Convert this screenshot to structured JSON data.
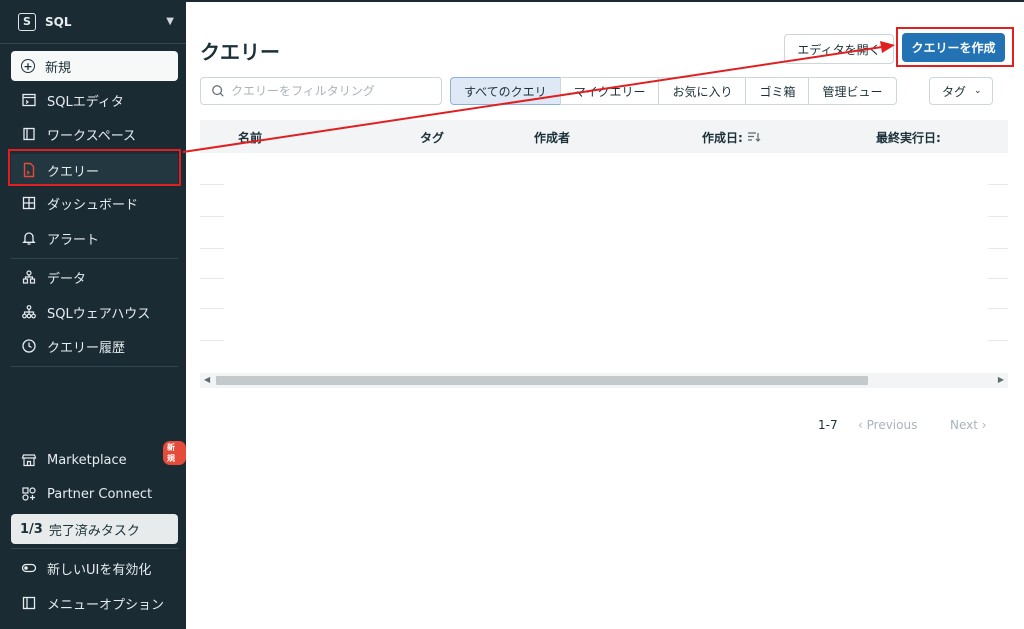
{
  "sidebar": {
    "app_name": "SQL",
    "logo_letter": "S",
    "new_label": "新規",
    "items": [
      {
        "label": "SQLエディタ",
        "icon": "sql-editor-icon"
      },
      {
        "label": "ワークスペース",
        "icon": "workspace-icon"
      },
      {
        "label": "クエリー",
        "icon": "query-icon"
      },
      {
        "label": "ダッシュボード",
        "icon": "dashboard-icon"
      },
      {
        "label": "アラート",
        "icon": "bell-icon"
      },
      {
        "label": "データ",
        "icon": "data-icon"
      },
      {
        "label": "SQLウェアハウス",
        "icon": "warehouse-icon"
      },
      {
        "label": "クエリー履歴",
        "icon": "clock-icon"
      },
      {
        "label": "Marketplace",
        "icon": "store-icon"
      },
      {
        "label": "Partner Connect",
        "icon": "partner-icon"
      },
      {
        "label": "新しいUIを有効化",
        "icon": "toggle-icon"
      },
      {
        "label": "メニューオプション",
        "icon": "panel-icon"
      }
    ],
    "marketplace_badge": "新規",
    "task_count": "1/3",
    "task_label": "完了済みタスク"
  },
  "main": {
    "title": "クエリー",
    "open_editor_label": "エディタを開く",
    "create_label": "クエリーを作成",
    "search_placeholder": "クエリーをフィルタリング",
    "filters": [
      "すべてのクエリ",
      "マイクエリー",
      "お気に入り",
      "ゴミ箱",
      "管理ビュー"
    ],
    "tag_label": "タグ",
    "columns": {
      "name": "名前",
      "tags": "タグ",
      "creator": "作成者",
      "created": "作成日:",
      "last_run": "最終実行日:"
    },
    "pager": {
      "range": "1-7",
      "previous": "Previous",
      "next": "Next"
    }
  },
  "colors": {
    "sidebar_bg": "#1b2b33",
    "primary": "#2272b4",
    "highlight": "#e02020",
    "active_query_icon": "#e44b3a"
  }
}
